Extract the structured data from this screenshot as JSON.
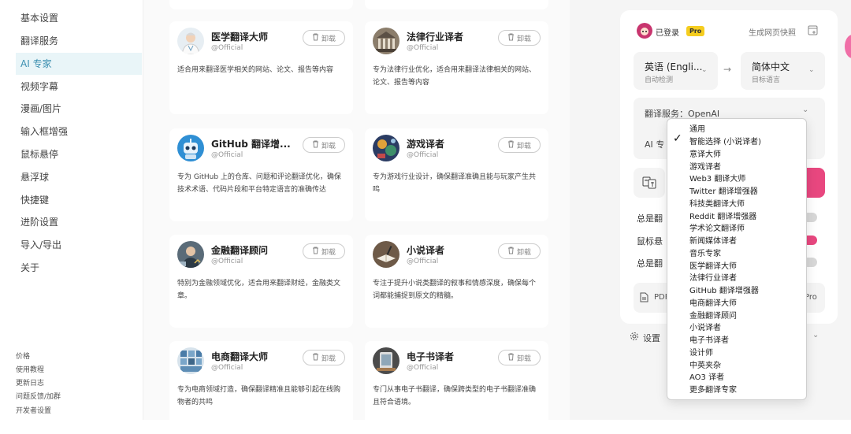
{
  "sidebar": {
    "items": [
      "基本设置",
      "翻译服务",
      "AI 专家",
      "视频字幕",
      "漫画/图片",
      "输入框增强",
      "鼠标悬停",
      "悬浮球",
      "快捷键",
      "进阶设置",
      "导入/导出",
      "关于"
    ],
    "active_index": 2,
    "footer": [
      "价格",
      "使用教程",
      "更新日志",
      "问题反馈/加群",
      "开发者设置"
    ]
  },
  "cards": [
    {
      "title": "医学翻译大师",
      "sub": "@Official",
      "uninstall": "卸载",
      "desc": "适合用来翻译医学相关的网站、论文、报告等内容",
      "avatar_icon": "doctor-avatar-icon"
    },
    {
      "title": "法律行业译者",
      "sub": "@Official",
      "uninstall": "卸载",
      "desc": "专为法律行业优化，适合用来翻译法律相关的网站、论文、报告等内容",
      "avatar_icon": "courthouse-avatar-icon"
    },
    {
      "title": "GitHub 翻译增...",
      "sub": "@Official",
      "uninstall": "卸载",
      "desc": "专为 GitHub 上的仓库、问题和评论翻译优化，确保技术术语、代码片段和平台特定语言的准确传达",
      "avatar_icon": "robot-avatar-icon"
    },
    {
      "title": "游戏译者",
      "sub": "@Official",
      "uninstall": "卸载",
      "desc": "专为游戏行业设计，确保翻译准确且能与玩家产生共鸣",
      "avatar_icon": "game-avatar-icon"
    },
    {
      "title": "金融翻译顾问",
      "sub": "@Official",
      "uninstall": "卸载",
      "desc": "特别为金融领域优化，适合用来翻译财经，金融类文章。",
      "avatar_icon": "finance-avatar-icon"
    },
    {
      "title": "小说译者",
      "sub": "@Official",
      "uninstall": "卸载",
      "desc": "专注于提升小说类翻译的叙事和情感深度，确保每个词都能捕捉到原文的精髓。",
      "avatar_icon": "book-avatar-icon"
    },
    {
      "title": "电商翻译大师",
      "sub": "@Official",
      "uninstall": "卸载",
      "desc": "专为电商领域打造，确保翻译精准且能够引起在线购物者的共鸣",
      "avatar_icon": "ecommerce-avatar-icon"
    },
    {
      "title": "电子书译者",
      "sub": "@Official",
      "uninstall": "卸载",
      "desc": "专门从事电子书翻译，确保跨类型的电子书翻译准确且符合语境。",
      "avatar_icon": "ebook-avatar-icon"
    }
  ],
  "panel": {
    "logged_in": "已登录",
    "pro_badge": "Pro",
    "snapshot": "生成网页快照",
    "source_lang": "英语 (Engli...",
    "source_sub": "自动检测",
    "target_lang": "简体中文",
    "target_sub": "目标语言",
    "service_label": "翻译服务：OpenAI",
    "ai_label": "AI 专",
    "toggle_labels": [
      "总是翻",
      "鼠标悬",
      "总是翻"
    ],
    "pdf_label": "PDF",
    "pdf_pro": "Pro",
    "settings": "设置"
  },
  "dropdown": {
    "options": [
      "通用",
      "智能选择 (小说译者)",
      "意译大师",
      "游戏译者",
      "Web3 翻译大师",
      "Twitter 翻译增强器",
      "科技类翻译大师",
      "Reddit 翻译增强器",
      "学术论文翻译师",
      "新闻媒体译者",
      "音乐专家",
      "医学翻译大师",
      "法律行业译者",
      "GitHub 翻译增强器",
      "电商翻译大师",
      "金融翻译顾问",
      "小说译者",
      "电子书译者",
      "设计师",
      "中英夹杂",
      "AO3 译者",
      "更多翻译专家"
    ],
    "selected_index": 1
  },
  "colors": {
    "accent": "#3b8fb0",
    "pink": "#e8477f",
    "badge": "#f5cd1f"
  }
}
